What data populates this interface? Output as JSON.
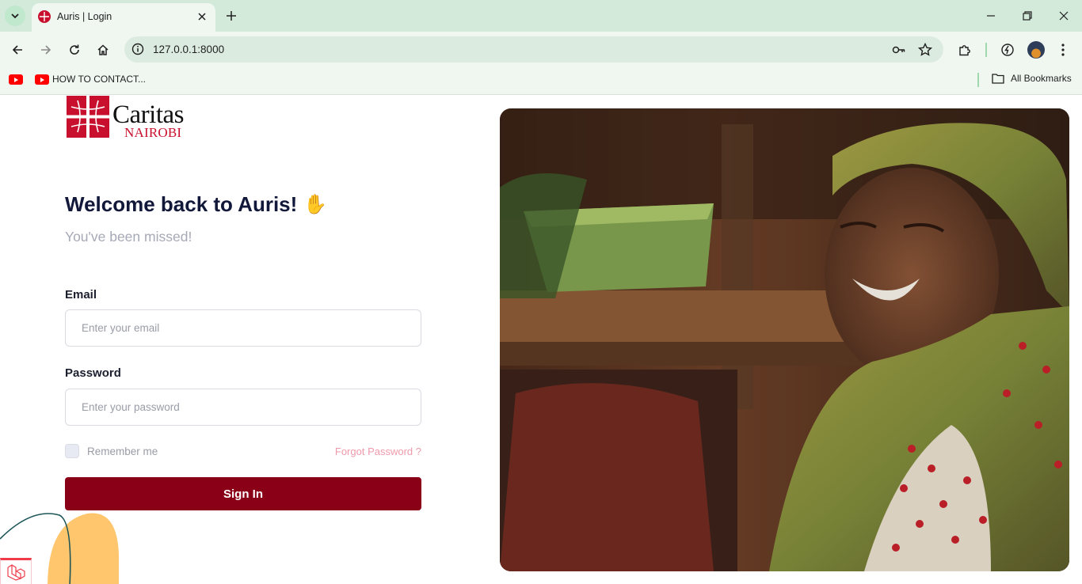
{
  "browser": {
    "tab_title": "Auris | Login",
    "url": "127.0.0.1:8000",
    "bookmark_label": "HOW TO CONTACT...",
    "all_bookmarks_label": "All Bookmarks"
  },
  "logo": {
    "word": "Caritas",
    "sub": "NAIROBI"
  },
  "login": {
    "title": "Welcome back to Auris!",
    "wave": "✋",
    "subtitle": "You've been missed!",
    "email_label": "Email",
    "email_placeholder": "Enter your email",
    "password_label": "Password",
    "password_placeholder": "Enter your password",
    "remember_label": "Remember me",
    "forgot_label": "Forgot Password ?",
    "submit_label": "Sign In"
  },
  "colors": {
    "brand_red": "#8a0016",
    "logo_red": "#c8102e",
    "tab_bar": "#d3eadb",
    "accent_yellow": "#ffc66e"
  }
}
